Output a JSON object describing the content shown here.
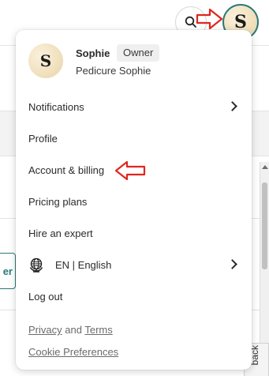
{
  "header": {
    "avatar_initial": "S"
  },
  "user": {
    "avatar_initial": "S",
    "name": "Sophie",
    "role": "Owner",
    "business": "Pedicure Sophie"
  },
  "menu": {
    "notifications": "Notifications",
    "profile": "Profile",
    "account_billing": "Account & billing",
    "pricing_plans": "Pricing plans",
    "hire_expert": "Hire an expert",
    "language": "EN | English",
    "logout": "Log out"
  },
  "footer": {
    "privacy": "Privacy",
    "and": "and",
    "terms": "Terms",
    "cookie_prefs": "Cookie Preferences"
  },
  "background": {
    "partial_button_text": "er",
    "feedback_text": "back"
  },
  "colors": {
    "accent": "#2a7a78",
    "annotation": "#e0261f"
  }
}
